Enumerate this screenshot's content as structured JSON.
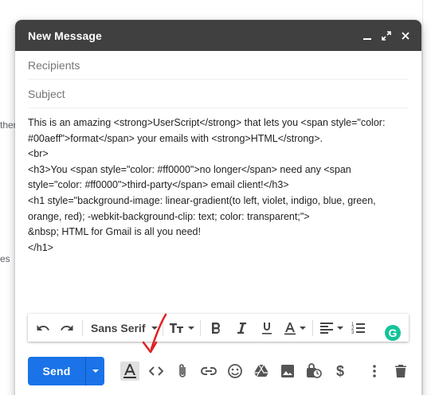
{
  "background": {
    "fragment_1": "ther",
    "fragment_2": "es"
  },
  "compose": {
    "title": "New Message",
    "recipients_placeholder": "Recipients",
    "subject_placeholder": "Subject",
    "body_lines": [
      "This is an amazing <strong>UserScript</strong> that lets you <span style=\"color:",
      "#00aeff\">format</span> your emails with <strong>HTML</strong>.",
      "<br>",
      "<h3>You <span style=\"color: #ff0000\">no longer</span> need any <span",
      "style=\"color: #ff0000\">third-party</span> email client!</h3>",
      "<h1 style=\"background-image: linear-gradient(to left, violet, indigo, blue, green,",
      "orange, red); -webkit-background-clip: text; color: transparent;\">",
      "&nbsp; HTML for Gmail is all you need!",
      "</h1>"
    ]
  },
  "toolbar": {
    "font_name": "Sans Serif",
    "grammarly_letter": "G"
  },
  "bottom_bar": {
    "send_label": "Send",
    "money_symbol": "$"
  },
  "colors": {
    "header_bg": "#404040",
    "send_blue": "#1a73e8",
    "annotation_red": "#e02020",
    "grammarly_green": "#15c39a"
  },
  "icons": [
    "minimize-icon",
    "popout-icon",
    "close-icon",
    "undo-icon",
    "redo-icon",
    "text-size-icon",
    "bold-icon",
    "italic-icon",
    "underline-icon",
    "text-color-icon",
    "align-icon",
    "numbered-list-icon",
    "formatting-options-icon",
    "html-code-icon",
    "attach-icon",
    "link-icon",
    "emoji-icon",
    "drive-icon",
    "photo-icon",
    "confidential-icon",
    "money-icon",
    "more-options-icon",
    "trash-icon"
  ]
}
